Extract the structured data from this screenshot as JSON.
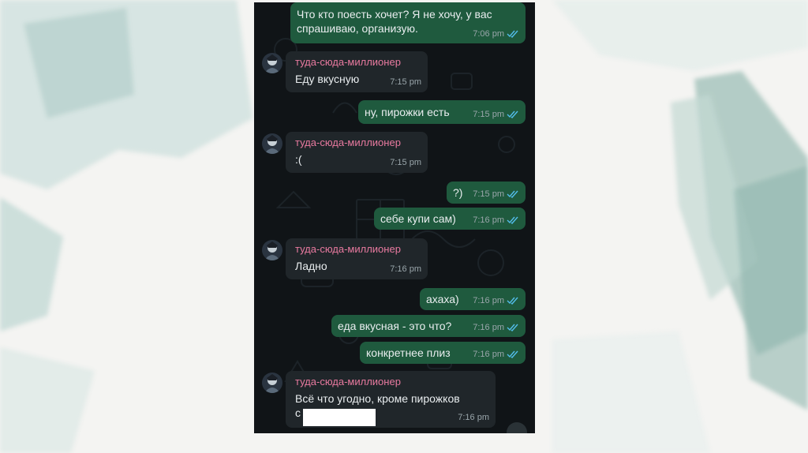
{
  "messages": [
    {
      "dir": "out",
      "text": "Что кто поесть хочет? Я не хочу, у вас\nспрашиваю, организую.",
      "time": "7:06 pm"
    },
    {
      "dir": "in",
      "sender": "туда-сюда-миллионер",
      "text": "Еду вкусную",
      "time": "7:15 pm"
    },
    {
      "dir": "out",
      "text": "ну, пирожки есть",
      "time": "7:15 pm"
    },
    {
      "dir": "in",
      "sender": "туда-сюда-миллионер",
      "text": ":(",
      "time": "7:15 pm"
    },
    {
      "dir": "out",
      "text": "?)",
      "time": "7:15 pm"
    },
    {
      "dir": "out",
      "text": "себе купи сам)",
      "time": "7:16 pm"
    },
    {
      "dir": "in",
      "sender": "туда-сюда-миллионер",
      "text": "Ладно",
      "time": "7:16 pm"
    },
    {
      "dir": "out",
      "text": "ахаха)",
      "time": "7:16 pm"
    },
    {
      "dir": "out",
      "text": "еда вкусная - это что?",
      "time": "7:16 pm"
    },
    {
      "dir": "out",
      "text": "конкретнее плиз",
      "time": "7:16 pm"
    },
    {
      "dir": "in",
      "sender": "туда-сюда-миллионер",
      "text": "Всё что угодно, кроме пирожков\nс",
      "time": "7:16 pm"
    }
  ],
  "colors": {
    "outgoing_bubble": "#1f5a3e",
    "incoming_bubble": "#20262a",
    "sender_name": "#e97aa0",
    "read_ticks": "#53bdeb",
    "chat_background": "#101417"
  },
  "icons": {
    "read_receipt": "double-check-icon",
    "avatar": "avatar-icon"
  }
}
